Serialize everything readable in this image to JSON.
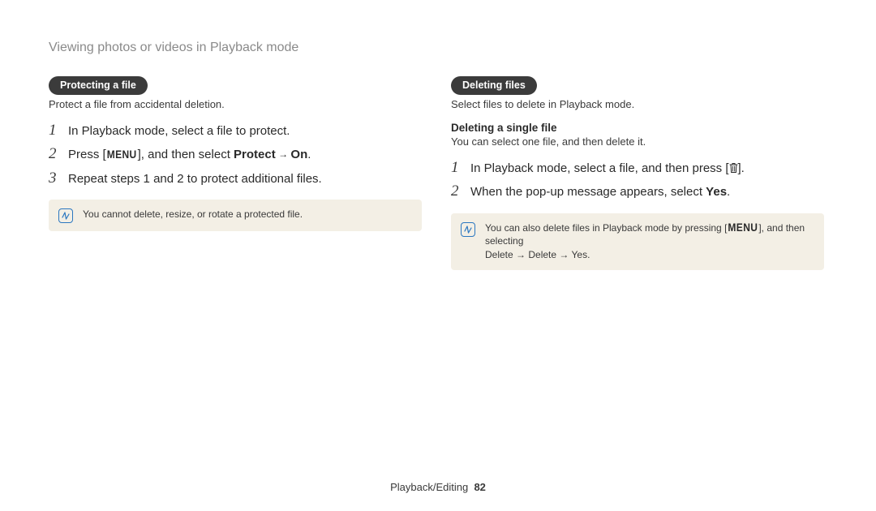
{
  "page_title": "Viewing photos or videos in Playback mode",
  "left": {
    "pill": "Protecting a file",
    "desc": "Protect a file from accidental deletion.",
    "steps": {
      "s1": "In Playback mode, select a file to protect.",
      "s2_pre": "Press [",
      "s2_menu": "MENU",
      "s2_mid": "], and then select ",
      "s2_b1": "Protect",
      "s2_arrow": " → ",
      "s2_b2": "On",
      "s2_post": ".",
      "s3": "Repeat steps 1 and 2 to protect additional files."
    },
    "note": "You cannot delete, resize, or rotate a protected file."
  },
  "right": {
    "pill": "Deleting files",
    "desc": "Select files to delete in Playback mode.",
    "sub_heading": "Deleting a single file",
    "sub_desc": "You can select one file, and then delete it.",
    "steps": {
      "s1_pre": "In Playback mode, select a file, and then press [",
      "s1_post": "].",
      "s2_pre": "When the pop-up message appears, select ",
      "s2_b": "Yes",
      "s2_post": "."
    },
    "note_pre": "You can also delete files in Playback mode by pressing [",
    "note_menu": "MENU",
    "note_mid": "], and then selecting ",
    "note_b": "Delete → Delete → Yes",
    "note_post": "."
  },
  "footer_section": "Playback/Editing",
  "footer_page": "82"
}
